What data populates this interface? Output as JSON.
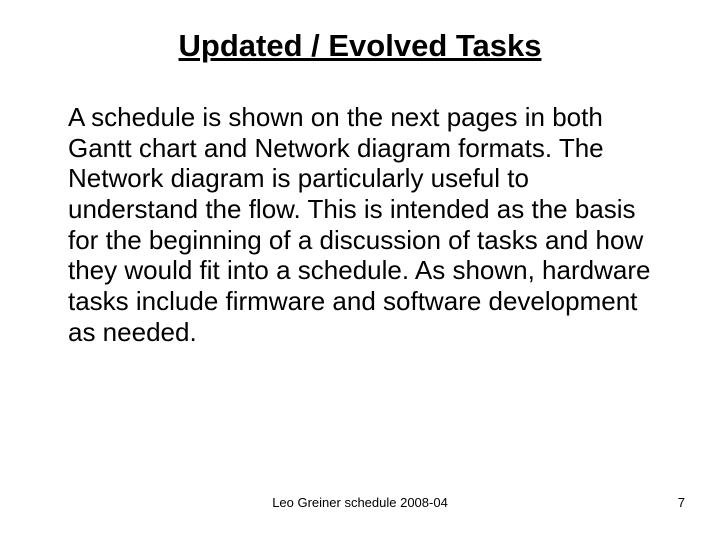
{
  "title": "Updated / Evolved Tasks",
  "body": "A schedule is shown on the next pages in both Gantt chart and Network diagram formats. The Network diagram is particularly useful to understand the flow. This is intended as the basis for the beginning of a discussion of tasks and how they would fit into a schedule. As shown, hardware tasks include firmware and software development as needed.",
  "footer": "Leo Greiner schedule 2008-04",
  "page_number": "7"
}
